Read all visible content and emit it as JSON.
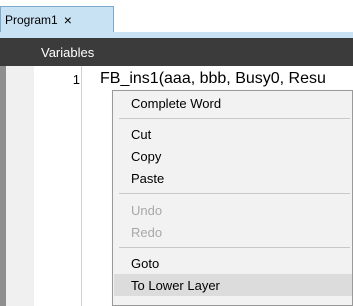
{
  "tab": {
    "label": "Program1",
    "close_glyph": "×"
  },
  "toolbar": {
    "variables_label": "Variables"
  },
  "editor": {
    "line_number": "1",
    "code": "FB_ins1(aaa, bbb, Busy0, Resu"
  },
  "context_menu": {
    "items": [
      {
        "label": "Complete Word",
        "enabled": true
      },
      {
        "label": "Cut",
        "enabled": true
      },
      {
        "label": "Copy",
        "enabled": true
      },
      {
        "label": "Paste",
        "enabled": true
      },
      {
        "label": "Undo",
        "enabled": false
      },
      {
        "label": "Redo",
        "enabled": false
      },
      {
        "label": "Goto",
        "enabled": true
      },
      {
        "label": "To Lower Layer",
        "enabled": true,
        "highlighted": true
      }
    ]
  },
  "colors": {
    "tab_background": "#c8e1f3",
    "variables_bar": "#3b3b3b",
    "menu_background": "#f2f2f2",
    "disabled_text": "#a8a8a8",
    "highlight": "#dcdcdc"
  }
}
